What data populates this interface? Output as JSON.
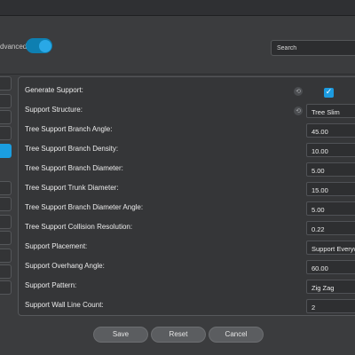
{
  "header": {
    "advanced_label": "dvanced",
    "advanced_toggle_on": true,
    "search_placeholder": "Search"
  },
  "sidebar": {
    "items": [
      {
        "active": false
      },
      {
        "active": false
      },
      {
        "active": false
      },
      {
        "active": false
      },
      {
        "active": true
      },
      {
        "active": false
      },
      {
        "active": false
      },
      {
        "active": false
      },
      {
        "active": false
      },
      {
        "active": false
      },
      {
        "active": false
      },
      {
        "active": false
      }
    ]
  },
  "settings": {
    "rows": [
      {
        "label": "Generate Support:",
        "type": "checkbox",
        "checked": true
      },
      {
        "label": "Support Structure:",
        "value": "Tree Slim"
      },
      {
        "label": "Tree Support Branch Angle:",
        "value": "45.00"
      },
      {
        "label": "Tree Support Branch Density:",
        "value": "10.00"
      },
      {
        "label": "Tree Support Branch Diameter:",
        "value": "5.00"
      },
      {
        "label": "Tree Support Trunk Diameter:",
        "value": "15.00"
      },
      {
        "label": "Tree Support Branch Diameter Angle:",
        "value": "5.00"
      },
      {
        "label": "Tree Support Collision Resolution:",
        "value": "0.22"
      },
      {
        "label": "Support Placement:",
        "value": "Support Everywhere"
      },
      {
        "label": "Support Overhang Angle:",
        "value": "60.00"
      },
      {
        "label": "Support Pattern:",
        "value": "Zig Zag"
      },
      {
        "label": "Support Wall Line Count:",
        "value": "2"
      }
    ]
  },
  "footer": {
    "save_label": "Save",
    "reset_label": "Reset",
    "cancel_label": "Cancel"
  },
  "colors": {
    "accent": "#1c9be0",
    "background": "#3b3c3e",
    "panel": "#353638"
  }
}
